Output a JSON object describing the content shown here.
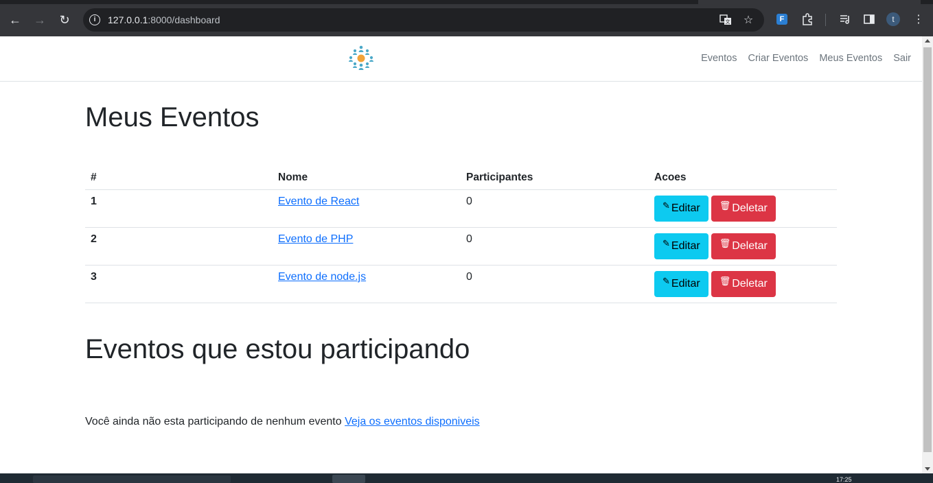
{
  "browser": {
    "url_host": "127.0.0.1",
    "url_rest": ":8000/dashboard",
    "profile_initial": "t",
    "extension_label": "F"
  },
  "site": {
    "nav": [
      "Eventos",
      "Criar Eventos",
      "Meus Eventos",
      "Sair"
    ]
  },
  "page": {
    "title": "Meus Eventos",
    "table": {
      "headers": [
        "#",
        "Nome",
        "Participantes",
        "Acoes"
      ],
      "rows": [
        {
          "id": "1",
          "name": "Evento de React",
          "participants": "0",
          "edit": "Editar",
          "delete": "Deletar"
        },
        {
          "id": "2",
          "name": "Evento de PHP",
          "participants": "0",
          "edit": "Editar",
          "delete": "Deletar"
        },
        {
          "id": "3",
          "name": "Evento de node.js",
          "participants": "0",
          "edit": "Editar",
          "delete": "Deletar"
        }
      ]
    },
    "participating_title": "Eventos que estou participando",
    "empty_message": "Você ainda não esta participando de nenhum evento",
    "empty_link": "Veja os eventos disponiveis"
  },
  "taskbar": {
    "clock": "17:25"
  },
  "colors": {
    "edit_button": "#0dcaf0",
    "delete_button": "#dc3545",
    "link": "#0d6efd"
  }
}
